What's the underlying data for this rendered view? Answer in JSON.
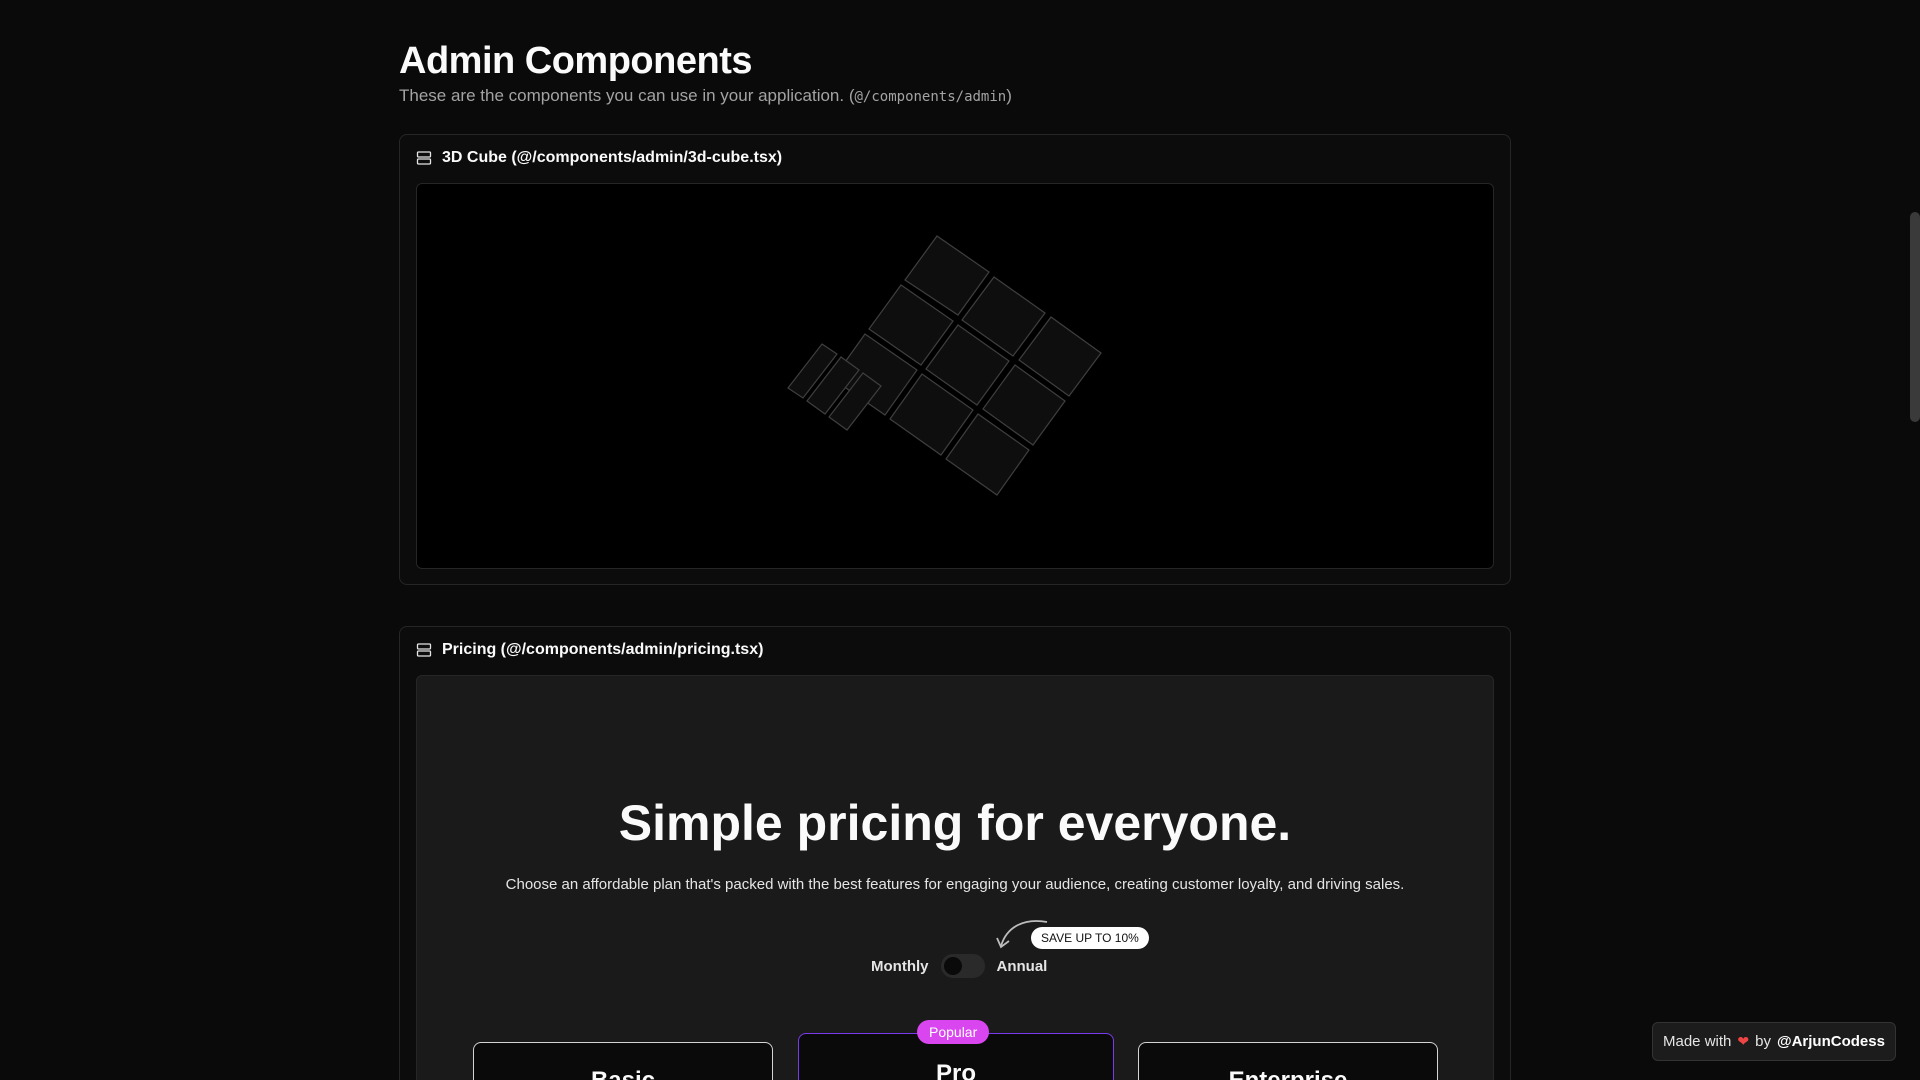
{
  "page": {
    "title": "Admin Components",
    "subtitle_text": "These are the components you can use in your application. (",
    "subtitle_code": "@/components/admin",
    "subtitle_end": ")"
  },
  "cube_panel": {
    "title": "3D Cube (@/components/admin/3d-cube.tsx)",
    "icon": "server-stack-icon"
  },
  "pricing_panel": {
    "title": "Pricing (@/components/admin/pricing.tsx)",
    "icon": "server-stack-icon",
    "heading": "Simple pricing for everyone.",
    "description": "Choose an affordable plan that's packed with the best features for engaging your audience, creating customer loyalty, and driving sales.",
    "toggle": {
      "monthly_label": "Monthly",
      "annual_label": "Annual",
      "save_badge": "SAVE UP TO 10%",
      "annual_selected": false
    },
    "popular_badge": "Popular",
    "plans": [
      {
        "name": "Basic"
      },
      {
        "name": "Pro"
      },
      {
        "name": "Enterprise"
      }
    ],
    "colors": {
      "popular": "#d946ef",
      "pro_border": "#7c3aed"
    }
  },
  "footer_badge": {
    "prefix": "Made with",
    "heart": "❤",
    "by": "by",
    "author": "@ArjunCodess"
  }
}
